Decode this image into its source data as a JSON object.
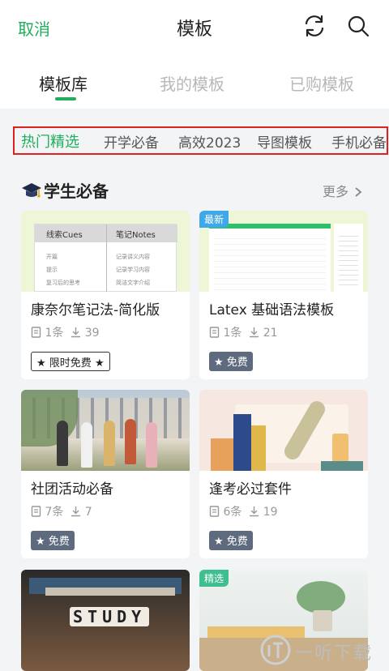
{
  "header": {
    "cancel_label": "取消",
    "title": "模板",
    "refresh_icon": "refresh-icon",
    "search_icon": "search-icon"
  },
  "tabs": [
    {
      "label": "模板库",
      "active": true
    },
    {
      "label": "我的模板",
      "active": false
    },
    {
      "label": "已购模板",
      "active": false
    }
  ],
  "categories": [
    {
      "label": "热门精选",
      "active": true
    },
    {
      "label": "开学必备",
      "active": false
    },
    {
      "label": "高效2023",
      "active": false
    },
    {
      "label": "导图模板",
      "active": false
    },
    {
      "label": "手机必备",
      "active": false
    }
  ],
  "section": {
    "title": "学生必备",
    "more_label": "更多"
  },
  "cards": [
    {
      "title": "康奈尔笔记法-简化版",
      "count": "1条",
      "views": "39",
      "tag": "限时免费",
      "badge": "",
      "thumb_cols": [
        "线索Cues",
        "笔记Notes"
      ],
      "thumb_left": [
        "开篇",
        "提示",
        "复习后的思考"
      ],
      "thumb_right": [
        "记录讲义内容",
        "记录学习内容",
        "简洁文字介绍"
      ]
    },
    {
      "title": "Latex 基础语法模板",
      "count": "1条",
      "views": "21",
      "tag": "免费",
      "badge": "最新"
    },
    {
      "title": "社团活动必备",
      "count": "7条",
      "views": "7",
      "tag": "免费",
      "badge": ""
    },
    {
      "title": "逢考必过套件",
      "count": "6条",
      "views": "19",
      "tag": "免费",
      "badge": ""
    },
    {
      "title": "",
      "count": "",
      "views": "",
      "tag": "",
      "badge": "",
      "thumb_text": "STUDY"
    },
    {
      "title": "",
      "count": "",
      "views": "",
      "tag": "",
      "badge": "精选"
    }
  ],
  "colors": {
    "accent": "#1fae5c",
    "tag_free_bg": "#5e6b7e",
    "badge_new": "#3ea8e8",
    "badge_pick": "#3fbf8f",
    "highlight_border": "#e02020"
  },
  "watermark": {
    "text": "一听下载",
    "logo_icon": "yt-logo-icon"
  }
}
